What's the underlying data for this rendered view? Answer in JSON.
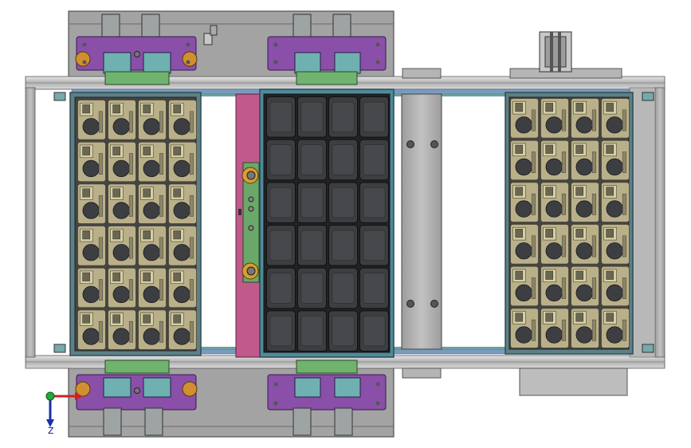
{
  "view": {
    "type": "CAD assembly top view",
    "background": "#ffffff"
  },
  "colors": {
    "frame": "#8a8a8a",
    "frame_dark": "#5a5a5a",
    "plate": "#bcbcbc",
    "plate_dark": "#9a9a9a",
    "bracket_purple": "#8a4fa8",
    "block_teal": "#6fb0b0",
    "rail_green": "#6fb36f",
    "pink_bar": "#c05a8a",
    "mover_green": "#6aa86a",
    "tray_outline": "#4f8a9a",
    "cell_tan": "#b9b08a",
    "cell_dark": "#3c3e42",
    "axis_y": "#1faa3a",
    "axis_x": "#d02020",
    "axis_z": "#1a2fa8"
  },
  "left_tray": {
    "rows": 6,
    "cols": 4,
    "fill": "tan"
  },
  "center_tray": {
    "rows": 6,
    "cols": 4,
    "fill": "dark"
  },
  "right_tray": {
    "rows": 6,
    "cols": 4,
    "fill": "tan"
  },
  "triad": {
    "label_z": "Z"
  }
}
